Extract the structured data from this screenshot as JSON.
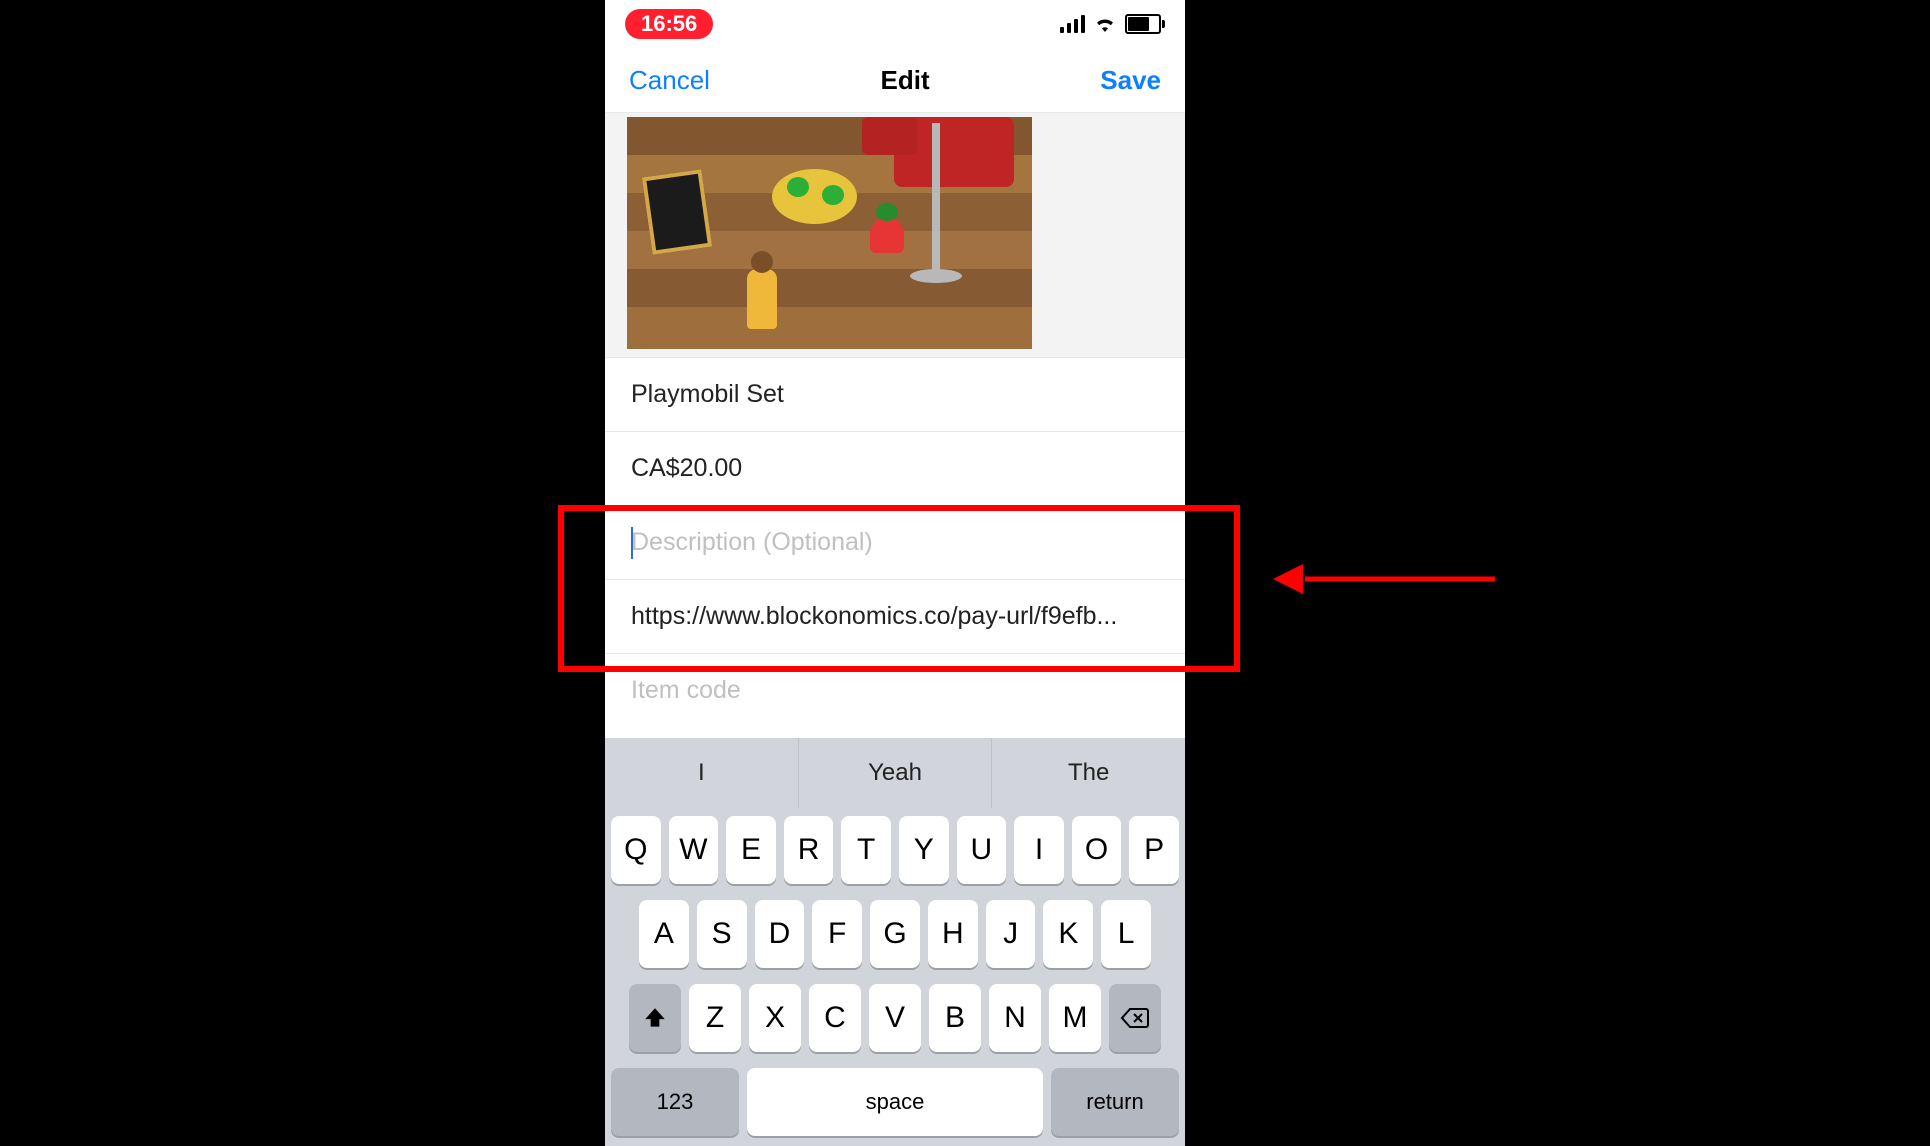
{
  "status": {
    "time": "16:56"
  },
  "nav": {
    "cancel": "Cancel",
    "title": "Edit",
    "save": "Save"
  },
  "form": {
    "name": "Playmobil Set",
    "price": "CA$20.00",
    "description_placeholder": "Description (Optional)",
    "url": "https://www.blockonomics.co/pay-url/f9efb...",
    "item_code_placeholder": "Item code"
  },
  "keyboard": {
    "suggestions": [
      "I",
      "Yeah",
      "The"
    ],
    "row1": [
      "Q",
      "W",
      "E",
      "R",
      "T",
      "Y",
      "U",
      "I",
      "O",
      "P"
    ],
    "row2": [
      "A",
      "S",
      "D",
      "F",
      "G",
      "H",
      "J",
      "K",
      "L"
    ],
    "row3": [
      "Z",
      "X",
      "C",
      "V",
      "B",
      "N",
      "M"
    ],
    "numbers_key": "123",
    "space_key": "space",
    "return_key": "return"
  }
}
